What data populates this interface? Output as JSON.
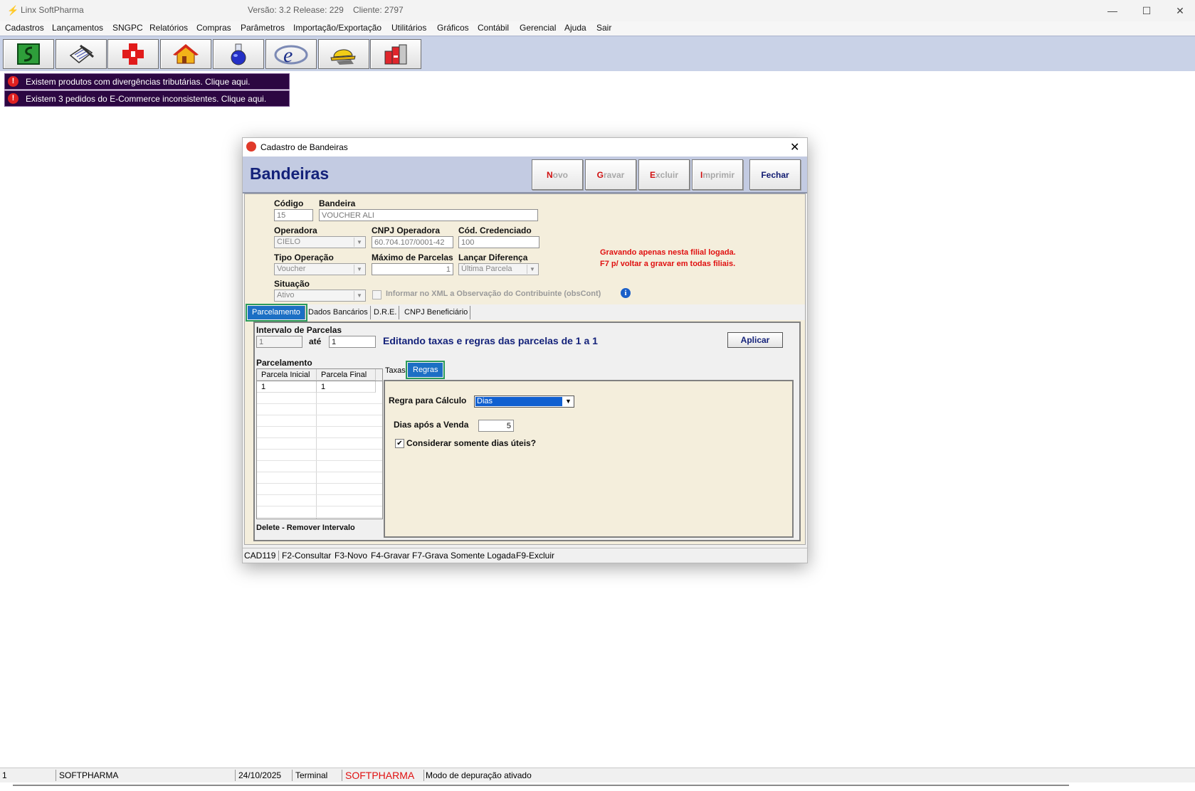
{
  "app": {
    "title": "Linx SoftPharma",
    "version": "Versão: 3.2 Release: 229",
    "client": "Cliente: 2797"
  },
  "menu": [
    "Cadastros",
    "Lançamentos",
    "SNGPC",
    "Relatórios",
    "Compras",
    "Parâmetros",
    "Importação/Exportação",
    "Utilitários",
    "Gráficos",
    "Contábil",
    "Gerencial",
    "Ajuda",
    "Sair"
  ],
  "toolbar_icons": [
    "money-icon",
    "notepad-icon",
    "pharmacy-cross-icon",
    "house-icon",
    "flask-icon",
    "nfe-icon",
    "helmet-icon",
    "books-icon"
  ],
  "alerts": [
    "Existem produtos com divergências tributárias. Clique aqui.",
    "Existem 3 pedidos do E-Commerce inconsistentes. Clique aqui."
  ],
  "dialog": {
    "title": "Cadastro de Bandeiras",
    "heading": "Bandeiras",
    "buttons": {
      "novo": {
        "key": "N",
        "rest": "ovo"
      },
      "gravar": {
        "key": "G",
        "rest": "ravar"
      },
      "excluir": {
        "key": "E",
        "rest": "xcluir"
      },
      "imprimir": {
        "key": "I",
        "rest": "mprimir"
      },
      "fechar": "Fechar"
    },
    "form": {
      "codigo_label": "Código",
      "codigo": "15",
      "bandeira_label": "Bandeira",
      "bandeira": "VOUCHER ALI",
      "operadora_label": "Operadora",
      "operadora": "CIELO",
      "cnpj_label": "CNPJ Operadora",
      "cnpj": "60.704.107/0001-42",
      "credenciado_label": "Cód. Credenciado",
      "credenciado": "100",
      "tipo_label": "Tipo Operação",
      "tipo": "Voucher",
      "max_parcelas_label": "Máximo de Parcelas",
      "max_parcelas": "1",
      "lancar_label": "Lançar Diferença",
      "lancar": "Última Parcela",
      "situacao_label": "Situação",
      "situacao": "Ativo",
      "xml_checkbox": "Informar no XML a Observação do Contribuinte (obsCont)",
      "warning_line1": "Gravando apenas nesta filial logada.",
      "warning_line2": "F7 p/ voltar a gravar em todas filiais."
    },
    "tabs": [
      "Parcelamento",
      "Dados Bancários",
      "D.R.E.",
      "CNPJ Beneficiário"
    ],
    "parcelamento": {
      "intervalo_label": "Intervalo de Parcelas",
      "de": "1",
      "ate_label": "até",
      "ate": "1",
      "editando": "Editando taxas e regras das parcelas de 1 a 1",
      "aplicar": "Aplicar",
      "grid_label": "Parcelamento",
      "grid_headers": [
        "Parcela Inicial",
        "Parcela Final"
      ],
      "grid_rows": [
        [
          "1",
          "1"
        ]
      ],
      "delete_hint": "Delete - Remover Intervalo",
      "subtabs": [
        "Taxas",
        "Regras"
      ],
      "regra_label": "Regra para Cálculo",
      "regra": "Dias",
      "dias_label": "Dias após a Venda",
      "dias": "5",
      "uteis_label": "Considerar somente dias úteis?"
    },
    "statusbar": [
      "CAD119",
      "F2-Consultar",
      "F3-Novo",
      "F4-Gravar",
      "F7-Grava Somente Logada",
      "F9-Excluir"
    ]
  },
  "statusbar": {
    "num": "1",
    "user": "SOFTPHARMA",
    "date": "24/10/2025",
    "terminal": "Terminal",
    "brand": "SOFTPHARMA",
    "mode": "Modo de depuração ativado"
  }
}
